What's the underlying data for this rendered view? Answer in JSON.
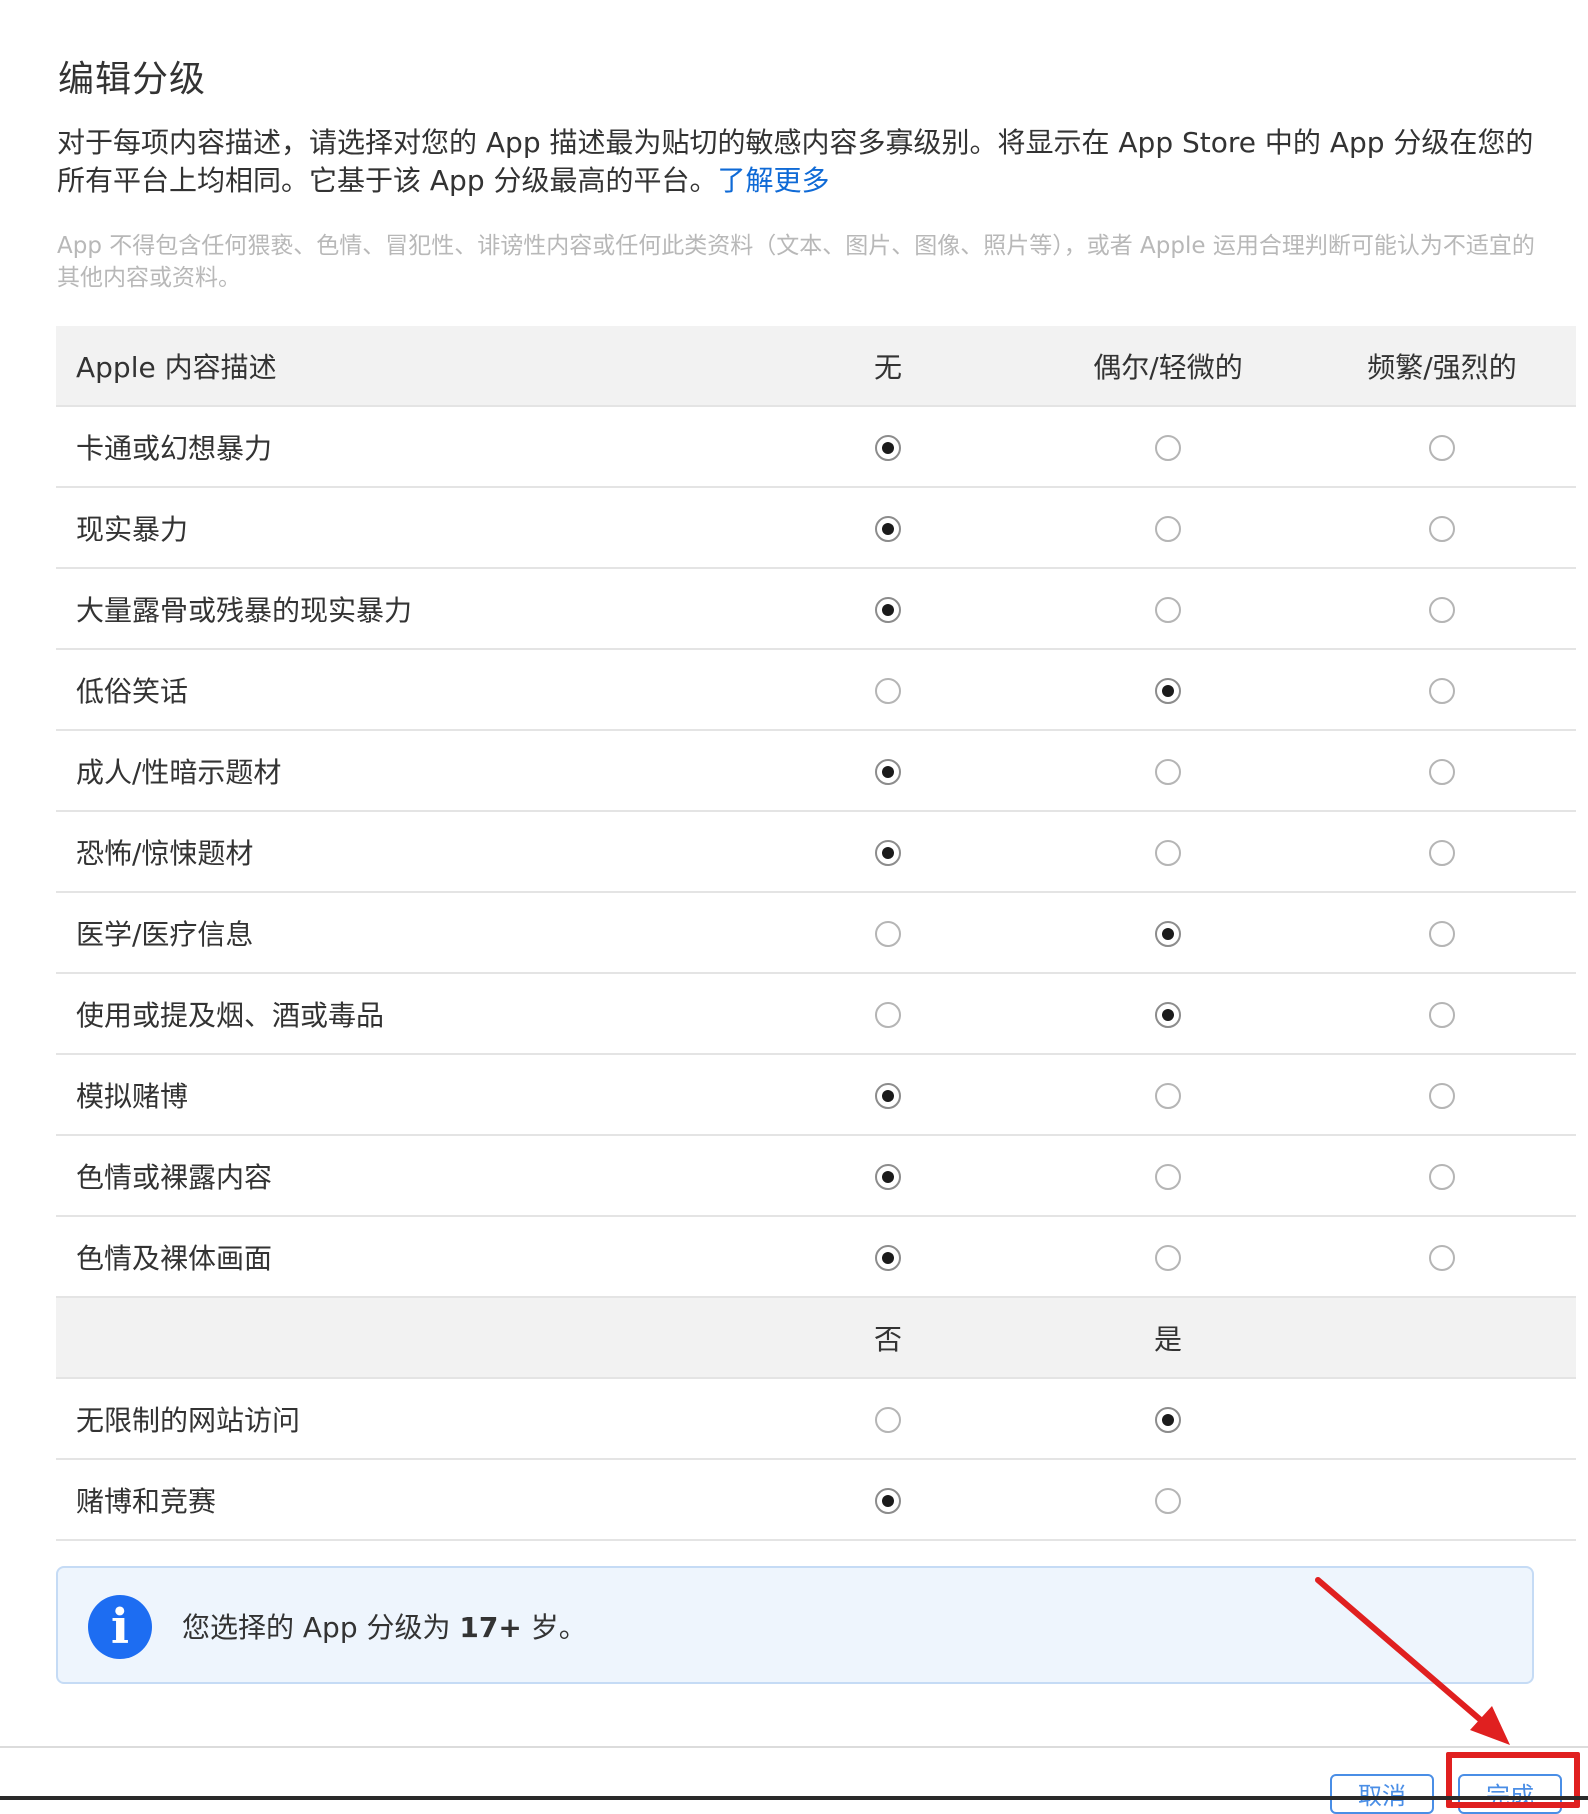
{
  "dialog": {
    "title": "编辑分级",
    "description": "对于每项内容描述，请选择对您的 App 描述最为贴切的敏感内容多寡级别。将显示在 App Store 中的 App 分级在您的所有平台上均相同。它基于该 App 分级最高的平台。",
    "learn_more": "了解更多",
    "note": "App 不得包含任何猥亵、色情、冒犯性、诽谤性内容或任何此类资料（文本、图片、图像、照片等），或者 Apple 运用合理判断可能认为不适宜的其他内容或资料。"
  },
  "table": {
    "headers": {
      "descriptor": "Apple 内容描述",
      "none": "无",
      "mild": "偶尔/轻微的",
      "frequent": "频繁/强烈的"
    },
    "rows": [
      {
        "label": "卡通或幻想暴力",
        "selected": "none"
      },
      {
        "label": "现实暴力",
        "selected": "none"
      },
      {
        "label": "大量露骨或残暴的现实暴力",
        "selected": "none"
      },
      {
        "label": "低俗笑话",
        "selected": "mild"
      },
      {
        "label": "成人/性暗示题材",
        "selected": "none"
      },
      {
        "label": "恐怖/惊悚题材",
        "selected": "none"
      },
      {
        "label": "医学/医疗信息",
        "selected": "mild"
      },
      {
        "label": "使用或提及烟、酒或毒品",
        "selected": "mild"
      },
      {
        "label": "模拟赌博",
        "selected": "none"
      },
      {
        "label": "色情或裸露内容",
        "selected": "none"
      },
      {
        "label": "色情及裸体画面",
        "selected": "none"
      }
    ],
    "yesno_headers": {
      "no": "否",
      "yes": "是"
    },
    "yesno_rows": [
      {
        "label": "无限制的网站访问",
        "selected": "yes"
      },
      {
        "label": "赌博和竞赛",
        "selected": "no"
      }
    ]
  },
  "info": {
    "prefix": "您选择的 App 分级为 ",
    "rating": "17+",
    "suffix": " 岁。"
  },
  "footer": {
    "cancel_label": "取消",
    "done_label": "完成"
  },
  "colors": {
    "link": "#0f6ad6",
    "info_icon": "#1d6df2",
    "highlight": "#e02020"
  }
}
